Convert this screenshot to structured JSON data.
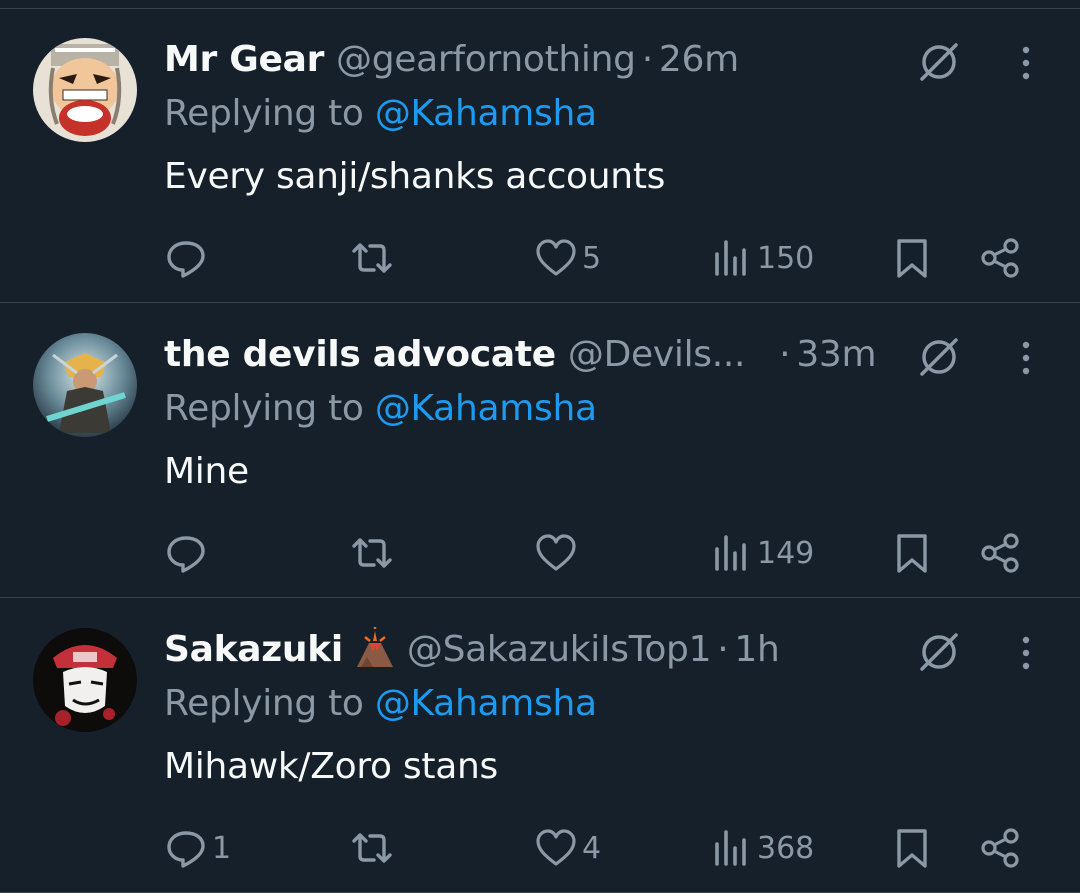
{
  "tweets": [
    {
      "author": "Mr Gear",
      "handle": "@gearfornothing",
      "separator": "·",
      "time": "26m",
      "reply_prefix": "Replying to ",
      "reply_to": "@Kahamsha",
      "text": "Every sanji/shanks accounts",
      "replies": "",
      "likes": "5",
      "views": "150"
    },
    {
      "author": "the devils advocate",
      "handle": "@Devils...",
      "separator": "·",
      "time": "33m",
      "reply_prefix": "Replying to ",
      "reply_to": "@Kahamsha",
      "text": "Mine",
      "replies": "",
      "likes": "",
      "views": "149"
    },
    {
      "author": "Sakazuki",
      "handle": "@SakazukiIsTop1",
      "separator": "·",
      "time": "1h",
      "reply_prefix": "Replying to ",
      "reply_to": "@Kahamsha",
      "text": "Mihawk/Zoro stans",
      "replies": "1",
      "likes": "4",
      "views": "368"
    }
  ],
  "icons": {
    "reply": "reply-icon",
    "retweet": "retweet-icon",
    "like": "heart-icon",
    "views": "views-icon",
    "bookmark": "bookmark-icon",
    "share": "share-icon",
    "grok": "grok-icon",
    "more": "more-icon",
    "volcano": "volcano-emoji-icon"
  },
  "colors": {
    "background": "#15202b",
    "divider": "#38444d",
    "text": "#f7f9f9",
    "muted": "#8b98a5",
    "link": "#1d9bf0"
  }
}
